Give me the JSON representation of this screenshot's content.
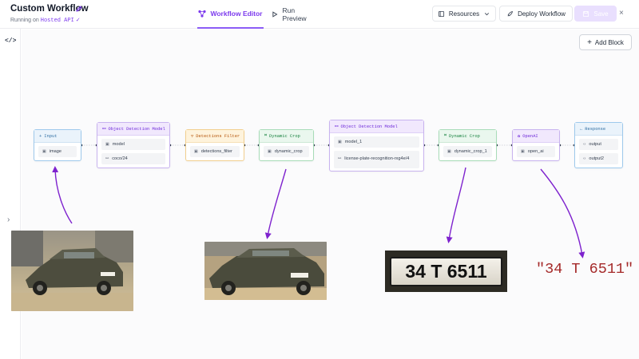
{
  "header": {
    "title": "Custom Workflow",
    "status_prefix": "Running on",
    "status_api": "Hosted API",
    "status_check": "✓",
    "tabs": [
      {
        "label": "Workflow Editor",
        "active": true,
        "icon": "workflow-icon"
      },
      {
        "label": "Run Preview",
        "active": false,
        "icon": "play-icon"
      }
    ],
    "resources_label": "Resources",
    "deploy_label": "Deploy Workflow",
    "save_label": "Save",
    "close_glyph": "×"
  },
  "rail": {
    "code_glyph": "</>",
    "expand_glyph": "›"
  },
  "canvas": {
    "add_block_label": "Add Block",
    "add_block_glyph": "+"
  },
  "blocks": [
    {
      "id": "input",
      "title": "Input",
      "head_glyph": "+",
      "color": "blue",
      "fields": [
        {
          "icon": "image-icon",
          "label": "image"
        }
      ]
    },
    {
      "id": "object-detection-1",
      "title": "Object Detection Model",
      "head_glyph": "⚯",
      "color": "purple",
      "fields": [
        {
          "icon": "model-icon",
          "label": "model"
        },
        {
          "icon": "link-icon",
          "label": "coco/24"
        }
      ]
    },
    {
      "id": "detections-filter",
      "title": "Detections Filter",
      "head_glyph": "▽",
      "color": "orange",
      "fields": [
        {
          "icon": "model-icon",
          "label": "detections_filter"
        }
      ]
    },
    {
      "id": "dynamic-crop-1",
      "title": "Dynamic Crop",
      "head_glyph": "⌗",
      "color": "green",
      "fields": [
        {
          "icon": "model-icon",
          "label": "dynamic_crop"
        }
      ]
    },
    {
      "id": "object-detection-2",
      "title": "Object Detection Model",
      "head_glyph": "⚯",
      "color": "purple",
      "fields": [
        {
          "icon": "model-icon",
          "label": "model_1"
        },
        {
          "icon": "link-icon",
          "label": "license-plate-recognition-rxg4e/4"
        }
      ]
    },
    {
      "id": "dynamic-crop-2",
      "title": "Dynamic Crop",
      "head_glyph": "⌗",
      "color": "green",
      "fields": [
        {
          "icon": "model-icon",
          "label": "dynamic_crop_1"
        }
      ]
    },
    {
      "id": "openai",
      "title": "OpenAI",
      "head_glyph": "✿",
      "color": "purple",
      "fields": [
        {
          "icon": "model-icon",
          "label": "open_ai"
        }
      ]
    },
    {
      "id": "response",
      "title": "Response",
      "head_glyph": "←",
      "color": "blue",
      "fields": [
        {
          "icon": "output-icon",
          "label": "output"
        },
        {
          "icon": "output-icon",
          "label": "output2"
        }
      ]
    }
  ],
  "illustration": {
    "plate_text": "34 T 6511",
    "result_text": "\"34 T 6511\"",
    "arrow_color": "#7e22ce",
    "result_color": "#a52a2a"
  }
}
